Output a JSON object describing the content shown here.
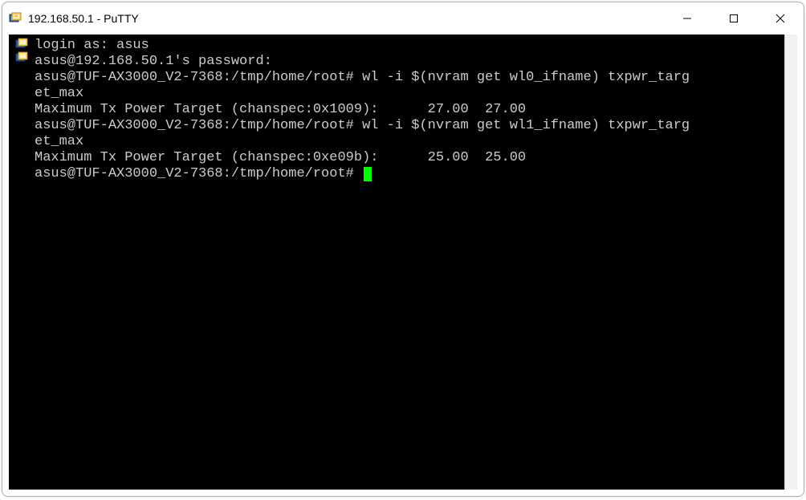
{
  "window": {
    "title": "192.168.50.1 - PuTTY"
  },
  "terminal": {
    "lines": [
      "login as: asus",
      "asus@192.168.50.1's password:",
      "asus@TUF-AX3000_V2-7368:/tmp/home/root# wl -i $(nvram get wl0_ifname) txpwr_targ",
      "et_max",
      "Maximum Tx Power Target (chanspec:0x1009):      27.00  27.00",
      "asus@TUF-AX3000_V2-7368:/tmp/home/root# wl -i $(nvram get wl1_ifname) txpwr_targ",
      "et_max",
      "Maximum Tx Power Target (chanspec:0xe09b):      25.00  25.00",
      "asus@TUF-AX3000_V2-7368:/tmp/home/root# "
    ],
    "prompt_line_index": 8
  }
}
